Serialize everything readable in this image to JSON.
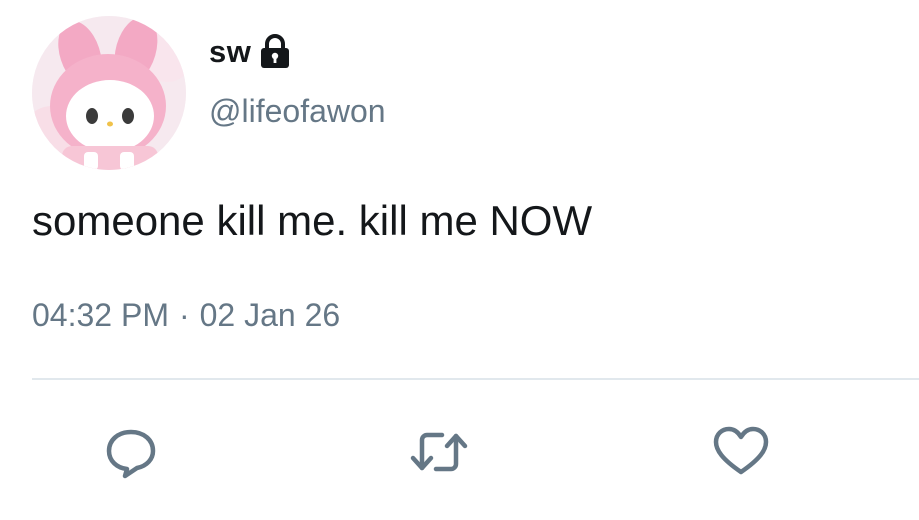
{
  "user": {
    "display_name": "sw",
    "handle": "@lifeofawon",
    "protected": true,
    "avatar_icon": "pink-bunny-character-avatar"
  },
  "tweet": {
    "text": "someone kill me. kill me NOW",
    "time": "04:32 PM",
    "separator": "·",
    "date": "02 Jan 26"
  },
  "actions": [
    {
      "name": "reply",
      "icon": "speech-bubble-icon"
    },
    {
      "name": "retweet",
      "icon": "retweet-arrows-icon"
    },
    {
      "name": "like",
      "icon": "heart-icon"
    }
  ],
  "colors": {
    "text_primary": "#14171a",
    "text_secondary": "#657786",
    "divider": "#e1e8ed",
    "icon": "#657786"
  }
}
